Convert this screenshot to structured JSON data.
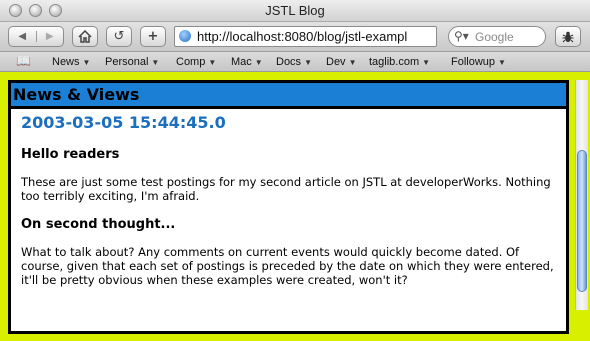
{
  "window": {
    "title": "JSTL Blog"
  },
  "toolbar": {
    "url": "http://localhost:8080/blog/jstl-exampl",
    "search_placeholder": "Google"
  },
  "bookmarks": [
    {
      "label": "News",
      "has_menu": true
    },
    {
      "label": "Personal",
      "has_menu": true
    },
    {
      "label": "Comp",
      "has_menu": true
    },
    {
      "label": "Mac",
      "has_menu": true
    },
    {
      "label": "Docs",
      "has_menu": true
    },
    {
      "label": "Dev",
      "has_menu": true
    },
    {
      "label": "taglib.com",
      "has_menu": true
    },
    {
      "label": "Followup",
      "has_menu": true
    }
  ],
  "page": {
    "panel_title": "News & Views",
    "date": "2003-03-05 15:44:45.0",
    "posts": [
      {
        "title": "Hello readers",
        "body": "These are just some test postings for my second article on JSTL at developerWorks. Nothing too terribly exciting, I'm afraid."
      },
      {
        "title": "On second thought...",
        "body": "What to talk about? Any comments on current events would quickly become dated. Of course, given that each set of postings is preceded by the date on which they were entered, it'll be pretty obvious when these examples were created, won't it?"
      }
    ]
  },
  "colors": {
    "page_background": "#d8f000",
    "panel_header": "#1b7fd6",
    "date_heading": "#1b6fbd"
  },
  "icons": {
    "back": "back-arrow-icon",
    "forward": "forward-arrow-icon",
    "home": "home-icon",
    "reload": "reload-icon",
    "add_bookmark": "plus-icon",
    "site": "globe-icon",
    "search": "magnifier-icon",
    "bug": "bug-icon",
    "bookmarks": "book-icon"
  }
}
